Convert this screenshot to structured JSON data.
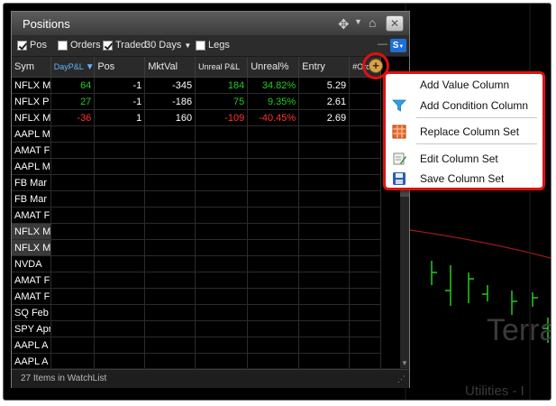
{
  "window": {
    "title": "Positions"
  },
  "options": {
    "pos_label": "Pos",
    "pos_checked": true,
    "orders_label": "Orders",
    "orders_checked": false,
    "traded_label": "Traded",
    "traded_checked": true,
    "traded_period": "30 Days",
    "legs_label": "Legs",
    "legs_checked": false,
    "s_badge": "S"
  },
  "table": {
    "headers": [
      "Sym",
      "DayP&L",
      "Pos",
      "MktVal",
      "Unreal P&L",
      "Unreal%",
      "Entry",
      "#Ord"
    ],
    "rows": [
      {
        "sym": "NFLX M",
        "daypl": "64",
        "pos": "-1",
        "mktval": "-345",
        "unrealpl": "184",
        "unrealpct": "34.82%",
        "entry": "5.29",
        "ord": "",
        "sel": false
      },
      {
        "sym": "NFLX P",
        "daypl": "27",
        "pos": "-1",
        "mktval": "-186",
        "unrealpl": "75",
        "unrealpct": "9.35%",
        "entry": "2.61",
        "ord": "",
        "sel": false
      },
      {
        "sym": "NFLX M",
        "daypl": "-36",
        "pos": "1",
        "mktval": "160",
        "unrealpl": "-109",
        "unrealpct": "-40.45%",
        "entry": "2.69",
        "ord": "",
        "sel": false
      },
      {
        "sym": "AAPL M",
        "daypl": "",
        "pos": "",
        "mktval": "",
        "unrealpl": "",
        "unrealpct": "",
        "entry": "",
        "ord": "",
        "sel": false
      },
      {
        "sym": "AMAT F",
        "daypl": "",
        "pos": "",
        "mktval": "",
        "unrealpl": "",
        "unrealpct": "",
        "entry": "",
        "ord": "",
        "sel": false
      },
      {
        "sym": "AAPL M",
        "daypl": "",
        "pos": "",
        "mktval": "",
        "unrealpl": "",
        "unrealpct": "",
        "entry": "",
        "ord": "",
        "sel": false
      },
      {
        "sym": "FB Mar",
        "daypl": "",
        "pos": "",
        "mktval": "",
        "unrealpl": "",
        "unrealpct": "",
        "entry": "",
        "ord": "",
        "sel": false
      },
      {
        "sym": "FB Mar",
        "daypl": "",
        "pos": "",
        "mktval": "",
        "unrealpl": "",
        "unrealpct": "",
        "entry": "",
        "ord": "",
        "sel": false
      },
      {
        "sym": "AMAT F",
        "daypl": "",
        "pos": "",
        "mktval": "",
        "unrealpl": "",
        "unrealpct": "",
        "entry": "",
        "ord": "",
        "sel": false
      },
      {
        "sym": "NFLX M",
        "daypl": "",
        "pos": "",
        "mktval": "",
        "unrealpl": "",
        "unrealpct": "",
        "entry": "",
        "ord": "",
        "sel": true
      },
      {
        "sym": "NFLX M",
        "daypl": "",
        "pos": "",
        "mktval": "",
        "unrealpl": "",
        "unrealpct": "",
        "entry": "",
        "ord": "",
        "sel": true
      },
      {
        "sym": "NVDA",
        "daypl": "",
        "pos": "",
        "mktval": "",
        "unrealpl": "",
        "unrealpct": "",
        "entry": "",
        "ord": "",
        "sel": false
      },
      {
        "sym": "AMAT F",
        "daypl": "",
        "pos": "",
        "mktval": "",
        "unrealpl": "",
        "unrealpct": "",
        "entry": "",
        "ord": "",
        "sel": false
      },
      {
        "sym": "AMAT F",
        "daypl": "",
        "pos": "",
        "mktval": "",
        "unrealpl": "",
        "unrealpct": "",
        "entry": "",
        "ord": "",
        "sel": false
      },
      {
        "sym": "SQ Feb",
        "daypl": "",
        "pos": "",
        "mktval": "",
        "unrealpl": "",
        "unrealpct": "",
        "entry": "",
        "ord": "",
        "sel": false
      },
      {
        "sym": "SPY Apr",
        "daypl": "",
        "pos": "",
        "mktval": "",
        "unrealpl": "",
        "unrealpct": "",
        "entry": "",
        "ord": "",
        "sel": false
      },
      {
        "sym": "AAPL A",
        "daypl": "",
        "pos": "",
        "mktval": "",
        "unrealpl": "",
        "unrealpct": "",
        "entry": "",
        "ord": "",
        "sel": false
      },
      {
        "sym": "AAPL A",
        "daypl": "",
        "pos": "",
        "mktval": "",
        "unrealpl": "",
        "unrealpct": "",
        "entry": "",
        "ord": "",
        "sel": false
      }
    ]
  },
  "status": {
    "text": "27 Items in WatchList"
  },
  "context_menu": {
    "items": [
      {
        "label": "Add Value Column",
        "icon": "none"
      },
      {
        "label": "Add Condition Column",
        "icon": "filter-icon"
      },
      {
        "label": "Replace Column Set",
        "icon": "grid-icon"
      },
      {
        "label": "Edit Column Set",
        "icon": "edit-icon"
      },
      {
        "label": "Save Column Set",
        "icon": "save-icon"
      }
    ]
  },
  "background": {
    "big_text": "Terra",
    "bottom_text": "Utilities - I"
  },
  "colors": {
    "positive": "#22cc22",
    "negative": "#ff3333",
    "highlight": "#e01010",
    "accent_blue": "#64b4ff"
  }
}
